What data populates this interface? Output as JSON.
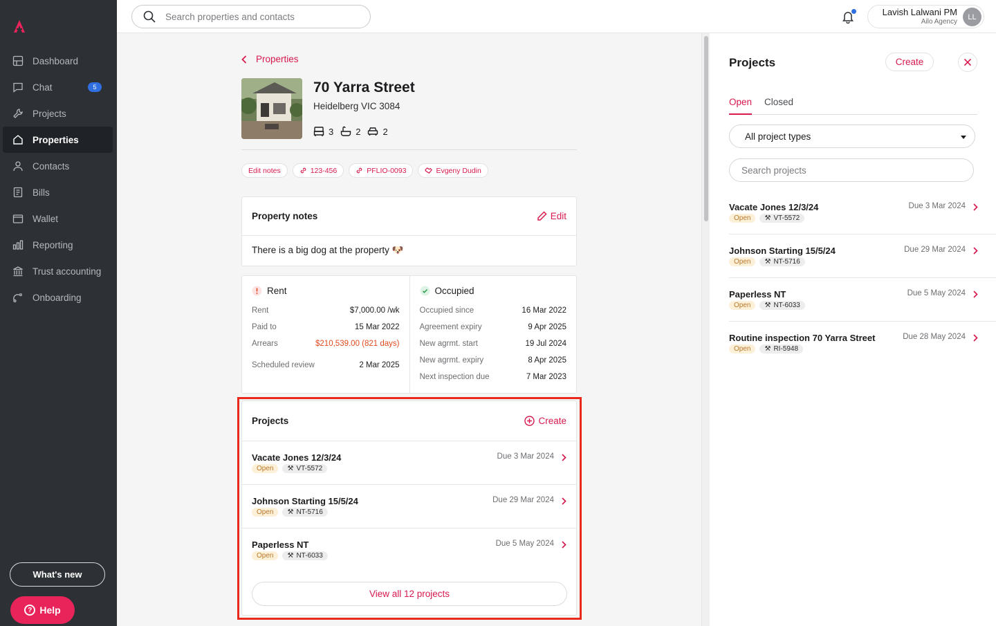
{
  "sidebar": {
    "items": [
      {
        "label": "Dashboard",
        "icon": "dashboard-icon"
      },
      {
        "label": "Chat",
        "icon": "chat-icon",
        "badge": "5"
      },
      {
        "label": "Projects",
        "icon": "wrench-icon"
      },
      {
        "label": "Properties",
        "icon": "home-icon",
        "active": true
      },
      {
        "label": "Contacts",
        "icon": "person-icon"
      },
      {
        "label": "Bills",
        "icon": "bill-icon"
      },
      {
        "label": "Wallet",
        "icon": "wallet-icon"
      },
      {
        "label": "Reporting",
        "icon": "bar-chart-icon"
      },
      {
        "label": "Trust accounting",
        "icon": "bank-icon"
      },
      {
        "label": "Onboarding",
        "icon": "onboarding-icon"
      }
    ],
    "whats_new": "What's new",
    "help": "Help"
  },
  "topbar": {
    "search_placeholder": "Search properties and contacts",
    "user_name": "Lavish Lalwani PM",
    "user_agency": "Ailo Agency",
    "avatar_initials": "LL"
  },
  "property": {
    "back_label": "Properties",
    "title": "70 Yarra Street",
    "address": "Heidelberg VIC 3084",
    "bedrooms": "3",
    "bathrooms": "2",
    "parking": "2",
    "chips": [
      "Edit notes",
      "123-456",
      "PFLIO-0093",
      "Evgeny Dudin"
    ]
  },
  "notes": {
    "title": "Property notes",
    "edit_label": "Edit",
    "text": "There is a big dog at the property 🐶"
  },
  "rent": {
    "title": "Rent",
    "rows": [
      {
        "k": "Rent",
        "v": "$7,000.00 /wk"
      },
      {
        "k": "Paid to",
        "v": "15 Mar 2022"
      },
      {
        "k": "Arrears",
        "v": "$210,539.00 (821 days)"
      },
      {
        "k": "Scheduled review",
        "v": "2 Mar 2025"
      }
    ]
  },
  "occupied": {
    "title": "Occupied",
    "rows": [
      {
        "k": "Occupied since",
        "v": "16 Mar 2022"
      },
      {
        "k": "Agreement expiry",
        "v": "9 Apr 2025"
      },
      {
        "k": "New agrmt. start",
        "v": "19 Jul 2024"
      },
      {
        "k": "New agrmt. expiry",
        "v": "8 Apr 2025"
      },
      {
        "k": "Next inspection due",
        "v": "7 Mar 2023"
      }
    ]
  },
  "projects_card": {
    "title": "Projects",
    "create_label": "Create",
    "items": [
      {
        "name": "Vacate Jones 12/3/24",
        "status": "Open",
        "code": "VT-5572",
        "due": "Due 3 Mar 2024"
      },
      {
        "name": "Johnson Starting 15/5/24",
        "status": "Open",
        "code": "NT-5716",
        "due": "Due 29 Mar 2024"
      },
      {
        "name": "Paperless NT",
        "status": "Open",
        "code": "NT-6033",
        "due": "Due 5 May 2024"
      }
    ],
    "view_all": "View all 12 projects"
  },
  "panel": {
    "title": "Projects",
    "create_label": "Create",
    "tabs": [
      "Open",
      "Closed"
    ],
    "filter_value": "All project types",
    "search_placeholder": "Search projects",
    "items": [
      {
        "name": "Vacate Jones 12/3/24",
        "status": "Open",
        "code": "VT-5572",
        "due": "Due 3 Mar 2024"
      },
      {
        "name": "Johnson Starting 15/5/24",
        "status": "Open",
        "code": "NT-5716",
        "due": "Due 29 Mar 2024"
      },
      {
        "name": "Paperless NT",
        "status": "Open",
        "code": "NT-6033",
        "due": "Due 5 May 2024"
      },
      {
        "name": "Routine inspection 70 Yarra Street",
        "status": "Open",
        "code": "RI-5948",
        "due": "Due 28 May 2024"
      }
    ]
  },
  "colors": {
    "brand": "#d7194e",
    "sidebar": "#2d3035",
    "highlight": "#e8291c"
  }
}
